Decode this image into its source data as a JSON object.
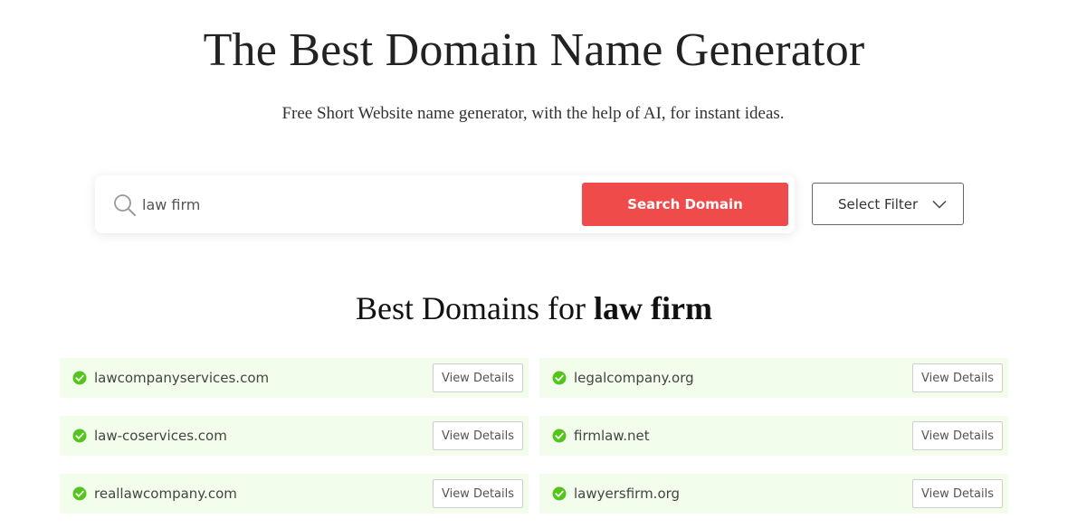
{
  "header": {
    "title": "The Best Domain Name Generator",
    "subtitle": "Free Short Website name generator, with the help of AI, for instant ideas."
  },
  "search": {
    "value": "law firm",
    "button_label": "Search Domain",
    "icon": "search-icon"
  },
  "filter": {
    "label": "Select Filter",
    "icon": "chevron-down-icon"
  },
  "results": {
    "heading_prefix": "Best Domains for",
    "heading_query": "law firm",
    "items": [
      {
        "domain": "lawcompanyservices.com",
        "action": "View Details"
      },
      {
        "domain": "legalcompany.org",
        "action": "View Details"
      },
      {
        "domain": "law-coservices.com",
        "action": "View Details"
      },
      {
        "domain": "firmlaw.net",
        "action": "View Details"
      },
      {
        "domain": "reallawcompany.com",
        "action": "View Details"
      },
      {
        "domain": "lawyersfirm.org",
        "action": "View Details"
      }
    ]
  },
  "colors": {
    "accent": "#ef4b4b",
    "card_background": "#f3fdec",
    "check": "#52c41a"
  }
}
